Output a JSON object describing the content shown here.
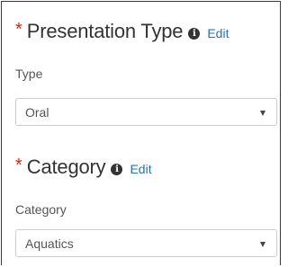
{
  "presentation_type": {
    "required_marker": "*",
    "title": "Presentation Type",
    "info_icon": "info-circle-icon",
    "edit_label": "Edit",
    "field_label": "Type",
    "selected_value": "Oral",
    "dropdown_icon": "caret-down-icon"
  },
  "category": {
    "required_marker": "*",
    "title": "Category",
    "info_icon": "info-circle-icon",
    "edit_label": "Edit",
    "field_label": "Category",
    "selected_value": "Aquatics",
    "dropdown_icon": "caret-down-icon"
  },
  "colors": {
    "required": "#d9230f",
    "link": "#2a6ebb",
    "heading": "#333333",
    "label": "#555555",
    "border": "#cccccc"
  }
}
